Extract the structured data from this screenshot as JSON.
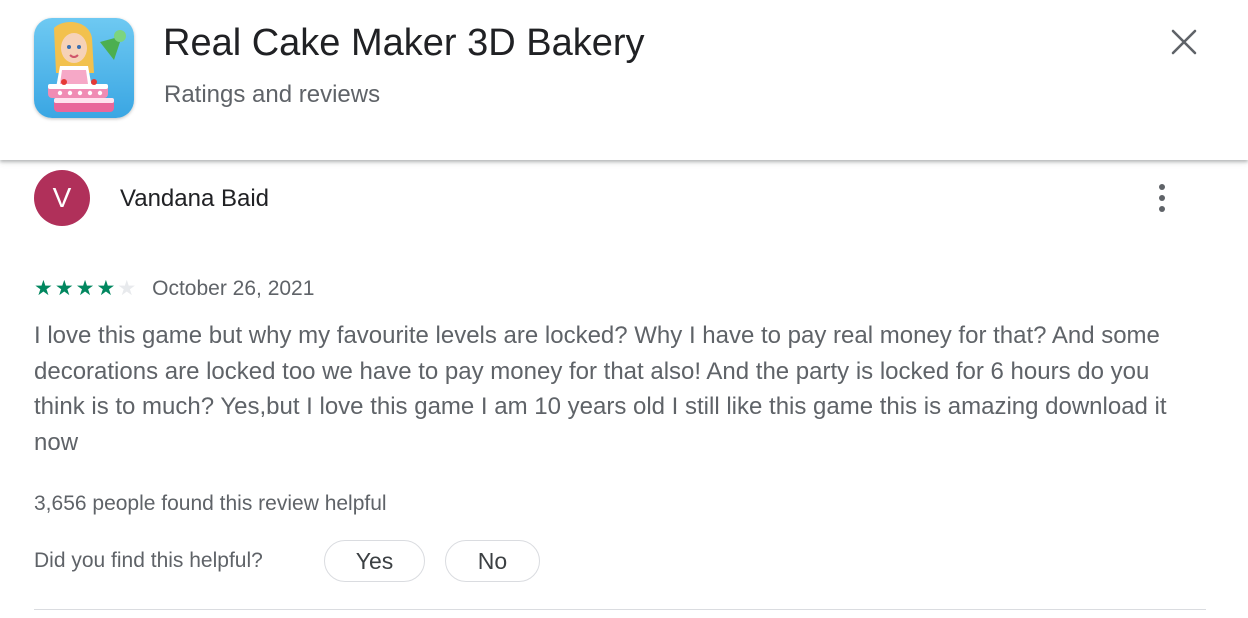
{
  "app": {
    "title": "Real Cake Maker 3D Bakery",
    "subtitle": "Ratings and reviews",
    "icon": "app-icon-cake-baker"
  },
  "controls": {
    "close_icon": "close-icon",
    "more_icon": "more-vert-icon"
  },
  "review": {
    "avatar_letter": "V",
    "avatar_color": "#b0305a",
    "reviewer_name": "Vandana Baid",
    "rating": 4,
    "rating_max": 5,
    "star_filled_color": "#01875f",
    "star_empty_color": "#e8eaed",
    "date": "October 26, 2021",
    "text": "I love this game but why my favourite levels are locked? Why I have to pay real money for that? And some decorations are locked too we have to pay money for that also! And the party is locked for 6 hours do you think is to much? Yes,but I love this game I am 10 years old I still like this game this is amazing download it now",
    "helpful_count_text": "3,656 people found this review helpful",
    "helpful_question": "Did you find this helpful?",
    "yes_label": "Yes",
    "no_label": "No"
  }
}
